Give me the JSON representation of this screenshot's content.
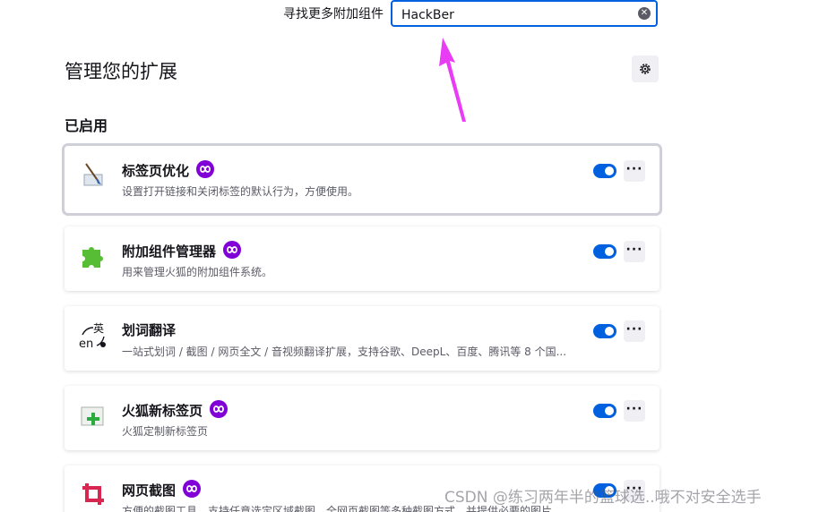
{
  "search": {
    "label": "寻找更多附加组件",
    "value": "HackBer"
  },
  "header": {
    "title": "管理您的扩展"
  },
  "section": {
    "title": "已启用"
  },
  "extensions": [
    {
      "name": "标签页优化",
      "desc": "设置打开链接和关闭标签的默认行为，方便使用。",
      "recommended": true,
      "enabled": true,
      "icon": "paintbrush-icon"
    },
    {
      "name": "附加组件管理器",
      "desc": "用来管理火狐的附加组件系统。",
      "recommended": true,
      "enabled": true,
      "icon": "puzzle-icon"
    },
    {
      "name": "划词翻译",
      "desc": "一站式划词 / 截图 / 网页全文 / 音视频翻译扩展，支持谷歌、DeepL、百度、腾讯等 8 个国...",
      "recommended": false,
      "enabled": true,
      "icon": "translate-icon"
    },
    {
      "name": "火狐新标签页",
      "desc": "火狐定制新标签页",
      "recommended": true,
      "enabled": true,
      "icon": "new-tab-icon"
    },
    {
      "name": "网页截图",
      "desc": "方便的截图工具，支持任意选定区域截图、全网页截图等多种截图方式，并提供必要的图片...",
      "recommended": true,
      "enabled": true,
      "icon": "crop-icon"
    }
  ],
  "watermark": "CSDN @练习两年半的篮球选..哦不对安全选手",
  "colors": {
    "accent": "#0061e0",
    "badge": "#8000d7",
    "annotation_arrow": "#e83cf5"
  }
}
